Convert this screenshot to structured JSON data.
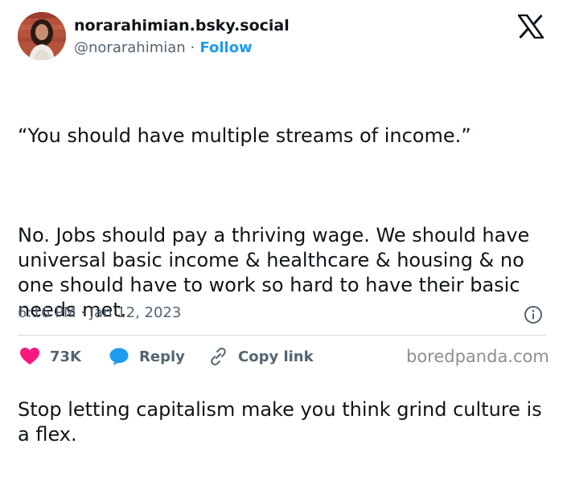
{
  "author": {
    "display_name": "norarahimian.bsky.social",
    "handle": "@norarahimian",
    "separator": "·",
    "follow_label": "Follow"
  },
  "tweet": {
    "paragraphs": [
      "“You should have multiple streams of income.”",
      "No. Jobs should pay a thriving wage. We should have universal basic income & healthcare & housing & no one should have to work so hard to have their basic needs met.",
      "Stop letting capitalism make you think grind culture is a flex."
    ],
    "time": "6:16 PM · Jan 12, 2023"
  },
  "actions": {
    "likes_count": "73K",
    "reply_label": "Reply",
    "copy_link_label": "Copy link"
  },
  "watermark": "boredpanda.com",
  "colors": {
    "like": "#f91880",
    "reply": "#1d9bf0",
    "follow": "#1d9bf0",
    "muted": "#536471"
  },
  "icons": {
    "brand": "x-logo-icon",
    "info": "info-icon",
    "like": "heart-icon",
    "reply": "speech-bubble-icon",
    "copy": "link-icon"
  }
}
